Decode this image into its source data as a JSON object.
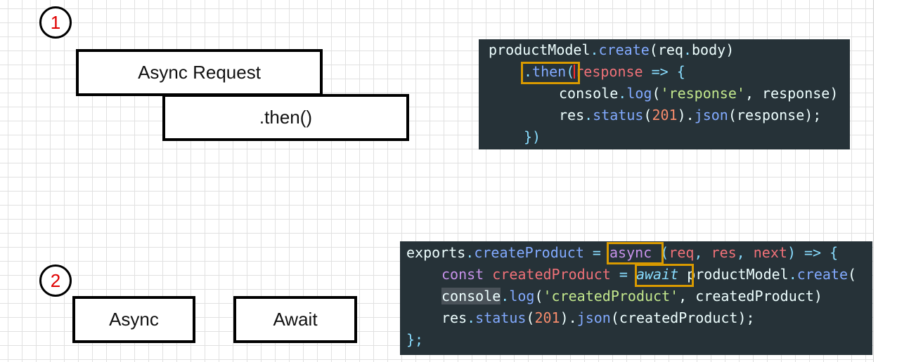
{
  "section1": {
    "number": "1",
    "async_request_label": "Async Request",
    "then_label": ".then()",
    "code": {
      "l1_a": "productModel",
      "l1_b": ".",
      "l1_c": "create",
      "l1_d": "(",
      "l1_e": "req",
      "l1_f": ".",
      "l1_g": "body",
      "l1_h": ")",
      "l2_a": ".",
      "l2_b": "then",
      "l2_c": "(",
      "l2_d": "response",
      "l2_e": " => {",
      "l3_a": "console",
      "l3_b": ".",
      "l3_c": "log",
      "l3_d": "(",
      "l3_e": "'response'",
      "l3_f": ", response)",
      "l4_a": "res",
      "l4_b": ".",
      "l4_c": "status",
      "l4_d": "(",
      "l4_e": "201",
      "l4_f": ").",
      "l4_g": "json",
      "l4_h": "(response);",
      "l5_a": "})"
    }
  },
  "section2": {
    "number": "2",
    "async_label": "Async",
    "await_label": "Await",
    "code": {
      "l1_a": "exports",
      "l1_b": ".",
      "l1_c": "createProduct",
      "l1_d": " = ",
      "l1_e": "async",
      "l1_f": " (",
      "l1_g": "req",
      "l1_h": ", ",
      "l1_i": "res",
      "l1_j": ", ",
      "l1_k": "next",
      "l1_l": ") => {",
      "l2_a": "const ",
      "l2_b": "createdProduct",
      "l2_c": " = ",
      "l2_d": "await",
      "l2_e": " productModel",
      "l2_f": ".",
      "l2_g": "create",
      "l2_h": "(",
      "l3_a": "console",
      "l3_b": ".",
      "l3_c": "log",
      "l3_d": "(",
      "l3_e": "'createdProduct'",
      "l3_f": ", createdProduct)",
      "l4_a": "res",
      "l4_b": ".",
      "l4_c": "status",
      "l4_d": "(",
      "l4_e": "201",
      "l4_f": ").",
      "l4_g": "json",
      "l4_h": "(createdProduct);",
      "l5_a": "};"
    }
  },
  "colors": {
    "code_background": "#263238",
    "highlight_border": "#d99a00",
    "marker_number": "#e00000",
    "grid_line": "#e1e1e1"
  }
}
